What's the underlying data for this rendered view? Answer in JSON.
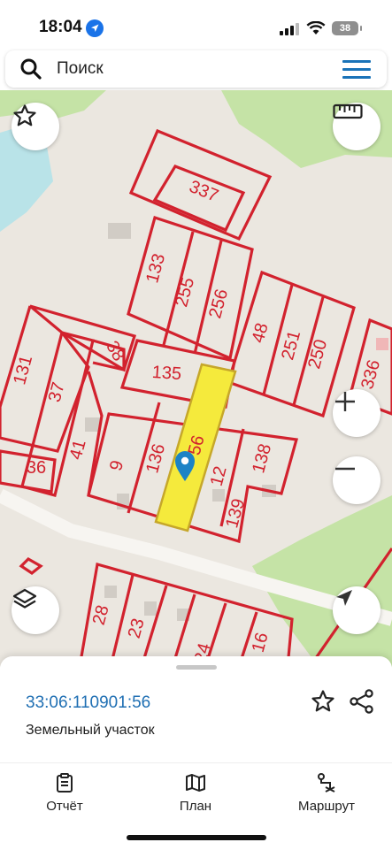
{
  "status": {
    "time": "18:04",
    "battery": "38"
  },
  "search": {
    "placeholder": "Поиск"
  },
  "map": {
    "parcels": {
      "p337": "337",
      "p133": "133",
      "p255": "255",
      "p256": "256",
      "p48": "48",
      "p251": "251",
      "p250": "250",
      "p131": "131",
      "p38": "38",
      "p135": "135",
      "p37": "37",
      "p336": "336",
      "p41": "41",
      "p36": "36",
      "p9": "9",
      "p136": "136",
      "p56": "56",
      "p12": "12",
      "p138": "138",
      "p139": "139",
      "p28": "28",
      "p23": "23",
      "p24": "24",
      "p16": "16"
    },
    "highlight_color": "#f5ea3c",
    "boundary_color": "#d2222e"
  },
  "controls": {
    "favorite_icon": "star-outline-icon",
    "ruler_icon": "ruler-icon",
    "zoom_in_icon": "plus-icon",
    "zoom_out_icon": "minus-icon",
    "layers_icon": "layers-icon",
    "locate_icon": "navigation-arrow-icon"
  },
  "sheet": {
    "cadastral_number": "33:06:110901:56",
    "object_type": "Земельный участок"
  },
  "tabs": [
    {
      "label": "Отчёт"
    },
    {
      "label": "План"
    },
    {
      "label": "Маршрут"
    }
  ]
}
